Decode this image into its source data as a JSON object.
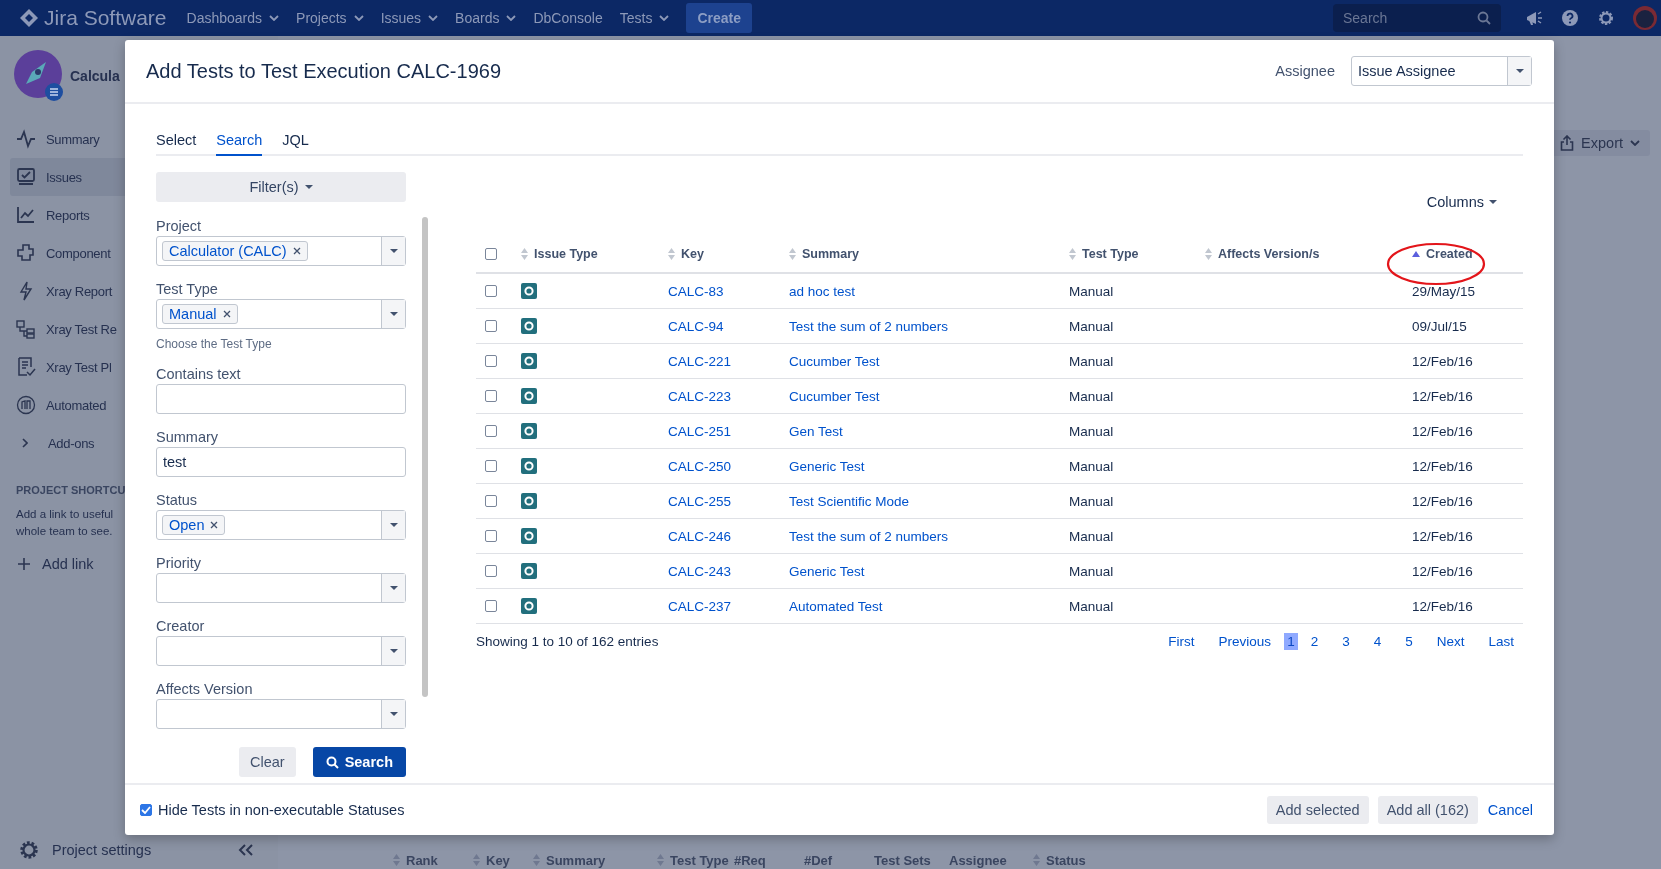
{
  "top_bar": {
    "product": "Jira Software",
    "nav": [
      {
        "label": "Dashboards",
        "dropdown": true
      },
      {
        "label": "Projects",
        "dropdown": true
      },
      {
        "label": "Issues",
        "dropdown": true
      },
      {
        "label": "Boards",
        "dropdown": true
      },
      {
        "label": "DbConsole",
        "dropdown": false
      },
      {
        "label": "Tests",
        "dropdown": true
      }
    ],
    "create_button": "Create",
    "search": {
      "placeholder": "Search"
    }
  },
  "sidebar": {
    "project_name": "Calcula",
    "items": [
      {
        "label": "Summary",
        "selected": false
      },
      {
        "label": "Issues",
        "selected": true
      },
      {
        "label": "Reports",
        "selected": false
      },
      {
        "label": "Component",
        "selected": false
      },
      {
        "label": "Xray Report",
        "selected": false
      },
      {
        "label": "Xray Test Re",
        "selected": false
      },
      {
        "label": "Xray Test Pl",
        "selected": false
      },
      {
        "label": "Automated",
        "selected": false
      }
    ],
    "addons": "Add-ons",
    "shortcuts_heading": "PROJECT SHORTCU",
    "shortcuts_text": [
      "Add a link to useful",
      "whole team to see."
    ],
    "add_link": "Add link",
    "settings": "Project settings"
  },
  "page": {
    "export_button": "Export",
    "columns": [
      {
        "label": "Rank",
        "sortable": true
      },
      {
        "label": "Key",
        "sortable": true
      },
      {
        "label": "Summary",
        "sortable": true
      },
      {
        "label": "Test Type",
        "sortable": true
      },
      {
        "label": "#Req",
        "sortable": false
      },
      {
        "label": "#Def",
        "sortable": false
      },
      {
        "label": "Test Sets",
        "sortable": false
      },
      {
        "label": "Assignee",
        "sortable": false
      },
      {
        "label": "Status",
        "sortable": true
      }
    ]
  },
  "dialog": {
    "title": "Add Tests to Test Execution CALC-1969",
    "assignee_label": "Assignee",
    "assignee_value": "Issue Assignee",
    "tabs": [
      {
        "label": "Select",
        "selected": false
      },
      {
        "label": "Search",
        "selected": true
      },
      {
        "label": "JQL",
        "selected": false
      }
    ],
    "filters_button": "Filter(s)",
    "fields": [
      {
        "label": "Project",
        "kind": "select",
        "tags": [
          "Calculator (CALC)"
        ]
      },
      {
        "label": "Test Type",
        "kind": "select",
        "tags": [
          "Manual"
        ],
        "hint": "Choose the Test Type"
      },
      {
        "label": "Contains text",
        "kind": "text"
      },
      {
        "label": "Summary",
        "kind": "text",
        "value": "test"
      },
      {
        "label": "Status",
        "kind": "select",
        "tags": [
          "Open"
        ]
      },
      {
        "label": "Priority",
        "kind": "select"
      },
      {
        "label": "Creator",
        "kind": "select"
      },
      {
        "label": "Affects Version",
        "kind": "select"
      }
    ],
    "clear_button": "Clear",
    "search_button": "Search",
    "columns_button": "Columns",
    "table": {
      "select_all": {
        "checked": false
      },
      "columns": [
        {
          "label": "Issue Type",
          "sorted": false,
          "circled": false
        },
        {
          "label": "Key",
          "sorted": false,
          "circled": false
        },
        {
          "label": "Summary",
          "sorted": false,
          "circled": false
        },
        {
          "label": "Test Type",
          "sorted": false,
          "circled": false
        },
        {
          "label": "Affects Version/s",
          "sorted": false,
          "circled": false
        },
        {
          "label": "Created",
          "sorted": true,
          "circled": true
        }
      ],
      "rows": [
        {
          "checked": false,
          "key": "CALC-83",
          "summary": "ad hoc test",
          "test_type": "Manual",
          "created": "29/May/15"
        },
        {
          "checked": false,
          "key": "CALC-94",
          "summary": "Test the sum of 2 numbers",
          "test_type": "Manual",
          "created": "09/Jul/15"
        },
        {
          "checked": false,
          "key": "CALC-221",
          "summary": "Cucumber Test",
          "test_type": "Manual",
          "created": "12/Feb/16"
        },
        {
          "checked": false,
          "key": "CALC-223",
          "summary": "Cucumber Test",
          "test_type": "Manual",
          "created": "12/Feb/16"
        },
        {
          "checked": false,
          "key": "CALC-251",
          "summary": "Gen Test",
          "test_type": "Manual",
          "created": "12/Feb/16"
        },
        {
          "checked": false,
          "key": "CALC-250",
          "summary": "Generic Test",
          "test_type": "Manual",
          "created": "12/Feb/16"
        },
        {
          "checked": false,
          "key": "CALC-255",
          "summary": "Test Scientific Mode",
          "test_type": "Manual",
          "created": "12/Feb/16"
        },
        {
          "checked": false,
          "key": "CALC-246",
          "summary": "Test the sum of 2 numbers",
          "test_type": "Manual",
          "created": "12/Feb/16"
        },
        {
          "checked": false,
          "key": "CALC-243",
          "summary": "Generic Test",
          "test_type": "Manual",
          "created": "12/Feb/16"
        },
        {
          "checked": false,
          "key": "CALC-237",
          "summary": "Automated Test",
          "test_type": "Manual",
          "created": "12/Feb/16"
        }
      ]
    },
    "entries_info": "Showing 1 to 10 of 162 entries",
    "pagination": [
      {
        "label": "First",
        "selected": false
      },
      {
        "label": "Previous",
        "selected": false
      },
      {
        "label": "1",
        "selected": true
      },
      {
        "label": "2",
        "selected": false
      },
      {
        "label": "3",
        "selected": false
      },
      {
        "label": "4",
        "selected": false
      },
      {
        "label": "5",
        "selected": false
      },
      {
        "label": "Next",
        "selected": false
      },
      {
        "label": "Last",
        "selected": false
      }
    ],
    "hide_tests": {
      "label": "Hide Tests in non-executable Statuses",
      "checked": true
    },
    "add_selected_button": "Add selected",
    "add_all_button": "Add all (162)",
    "cancel_link": "Cancel"
  }
}
